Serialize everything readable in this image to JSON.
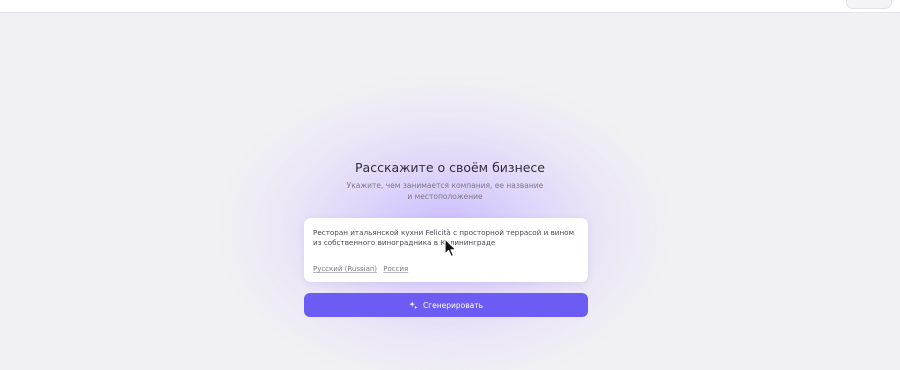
{
  "heading": {
    "title": "Расскажите о своём бизнесе",
    "subtitle": "Укажите, чем занимается компания, ее название и местоположение"
  },
  "description_card": {
    "text": "Ресторан итальянской кухни Felicità с просторной террасой и вином из собственного виноградника в Калининграде",
    "language_chip": "Русский (Russian)",
    "region_chip": "Россия"
  },
  "generate_button": {
    "label": "Сгенерировать",
    "icon": "sparkle-icon"
  },
  "colors": {
    "accent": "#6d5cf4",
    "background": "#f1f1f3",
    "glow": "#c4b2ff"
  }
}
